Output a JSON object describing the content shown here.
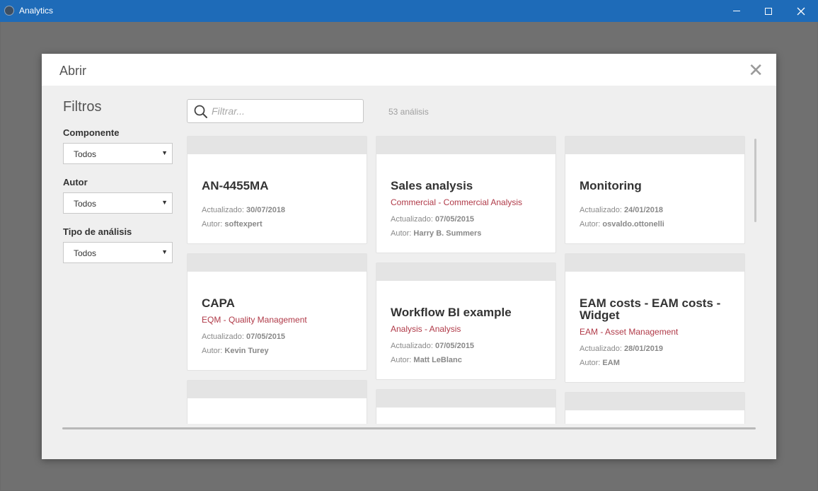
{
  "window": {
    "title": "Analytics"
  },
  "modal": {
    "title": "Abrir",
    "close_glyph": "✕"
  },
  "filters": {
    "title": "Filtros",
    "items": [
      {
        "label": "Componente",
        "value": "Todos"
      },
      {
        "label": "Autor",
        "value": "Todos"
      },
      {
        "label": "Tipo de análisis",
        "value": "Todos"
      }
    ]
  },
  "search": {
    "placeholder": "Filtrar...",
    "count": "53 análisis"
  },
  "meta_labels": {
    "updated": "Actualizado:",
    "author": "Autor:"
  },
  "cards": [
    {
      "title": "AN-4455MA",
      "component": "",
      "updated": "30/07/2018",
      "author": "softexpert"
    },
    {
      "title": "Sales analysis",
      "component": "Commercial - Commercial Analysis",
      "updated": "07/05/2015",
      "author": "Harry B. Summers"
    },
    {
      "title": "Monitoring",
      "component": "",
      "updated": "24/01/2018",
      "author": "osvaldo.ottonelli"
    },
    {
      "title": "CAPA",
      "component": "EQM - Quality Management",
      "updated": "07/05/2015",
      "author": "Kevin Turey"
    },
    {
      "title": "Workflow BI example",
      "component": "Analysis - Analysis",
      "updated": "07/05/2015",
      "author": "Matt LeBlanc"
    },
    {
      "title": "EAM costs - EAM costs - Widget",
      "component": "EAM - Asset Management",
      "updated": "28/01/2019",
      "author": "EAM"
    }
  ],
  "colors": {
    "titlebar": "#1e6bb8",
    "component_text": "#b03a48"
  }
}
